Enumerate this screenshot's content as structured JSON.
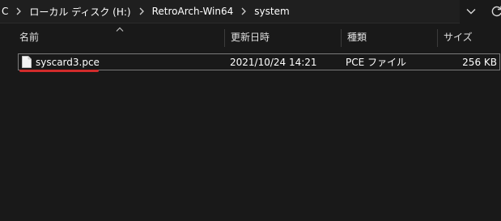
{
  "addressbar": {
    "crumbs": [
      "C",
      "ローカル ディスク (H:)",
      "RetroArch-Win64",
      "system"
    ]
  },
  "columns": {
    "name": "名前",
    "modified": "更新日時",
    "type": "種類",
    "size": "サイズ"
  },
  "files": [
    {
      "name": "syscard3.pce",
      "modified": "2021/10/24 14:21",
      "type": "PCE ファイル",
      "size": "256 KB"
    }
  ],
  "icons": {
    "separator": "chevron-right-icon",
    "dropdown": "chevron-down-icon",
    "refresh": "refresh-icon",
    "sort": "sort-ascending-icon",
    "file": "file-icon"
  },
  "colors": {
    "background": "#191919",
    "annotation": "#d12b2b"
  }
}
